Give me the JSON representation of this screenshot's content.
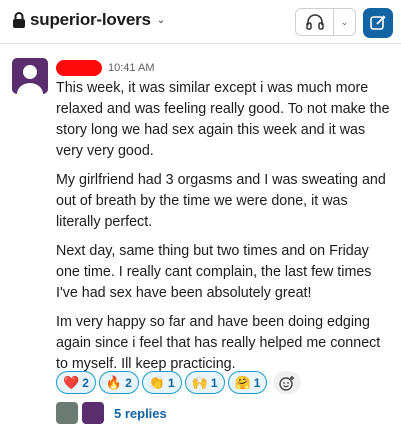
{
  "header": {
    "channel_name": "superior-lovers",
    "lock_icon": "lock-icon",
    "chevron_icon": "chevron-down-icon",
    "huddle_icon": "headphones-icon",
    "compose_icon": "compose-icon"
  },
  "message": {
    "time": "10:41 AM",
    "paragraphs": [
      "This week, it was similar except i was much more relaxed and was feeling really good. To not make the story long we had sex again this week and it was very very good.",
      "My girlfriend had 3 orgasms and I was sweating and out of breath by the time we were done, it was literally perfect.",
      "Next day, same thing but two times and on Friday one time. I really cant complain, the last few times I've had sex have been absolutely great!",
      "Im very happy so far and have been doing edging again since i feel that has really helped me connect to myself. Ill keep practicing."
    ]
  },
  "reactions": [
    {
      "emoji": "❤️",
      "count": "2"
    },
    {
      "emoji": "🔥",
      "count": "2"
    },
    {
      "emoji": "👏",
      "count": "1"
    },
    {
      "emoji": "🙌",
      "count": "1"
    },
    {
      "emoji": "🤗",
      "count": "1"
    }
  ],
  "thread": {
    "replies_label": "5 replies"
  },
  "colors": {
    "accent": "#1264a3",
    "avatar": "#5a2d6e",
    "redaction": "#ff0a0a"
  }
}
